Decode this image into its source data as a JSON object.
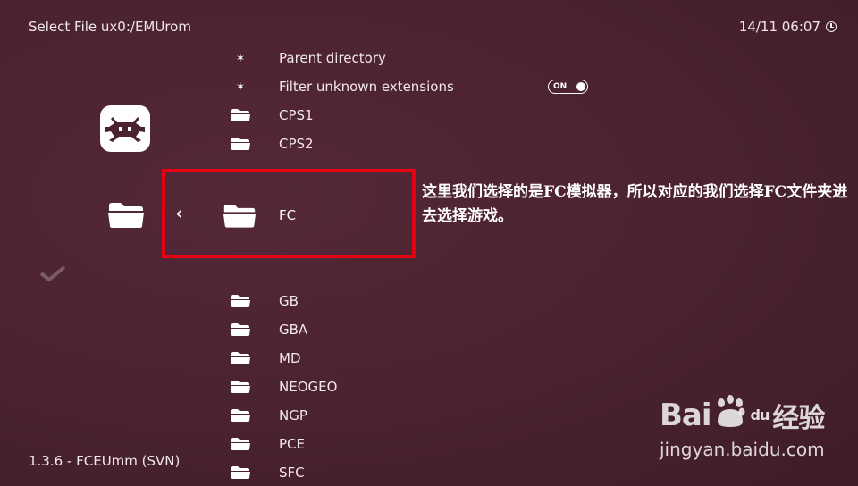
{
  "header": {
    "title": "Select File ux0:/EMUrom",
    "clock": "14/11 06:07"
  },
  "footer": {
    "version": "1.3.6 - FCEUmm (SVN)"
  },
  "menu": {
    "parent_directory": "Parent directory",
    "filter_unknown": "Filter unknown extensions",
    "filter_toggle": "ON",
    "folders_above": [
      "CPS1",
      "CPS2"
    ],
    "selected_folder": "FC",
    "folders_below": [
      "GB",
      "GBA",
      "MD",
      "NEOGEO",
      "NGP",
      "PCE",
      "SFC"
    ]
  },
  "annotation": {
    "text": "这里我们选择的是FC模拟器，所以对应的我们选择FC文件夹进去选择游戏。"
  },
  "watermark": {
    "brand": "Bai",
    "brand_du": "du",
    "brand_cn": "经验",
    "url": "jingyan.baidu.com"
  },
  "colors": {
    "background": "#4a2230",
    "highlight": "#e60012",
    "text": "#f2e8ec"
  },
  "icons": {
    "core": "retroarch-invader-icon",
    "folder": "folder-icon",
    "setting": "gear-icon",
    "back": "chevron-left-icon",
    "clock": "clock-icon"
  }
}
